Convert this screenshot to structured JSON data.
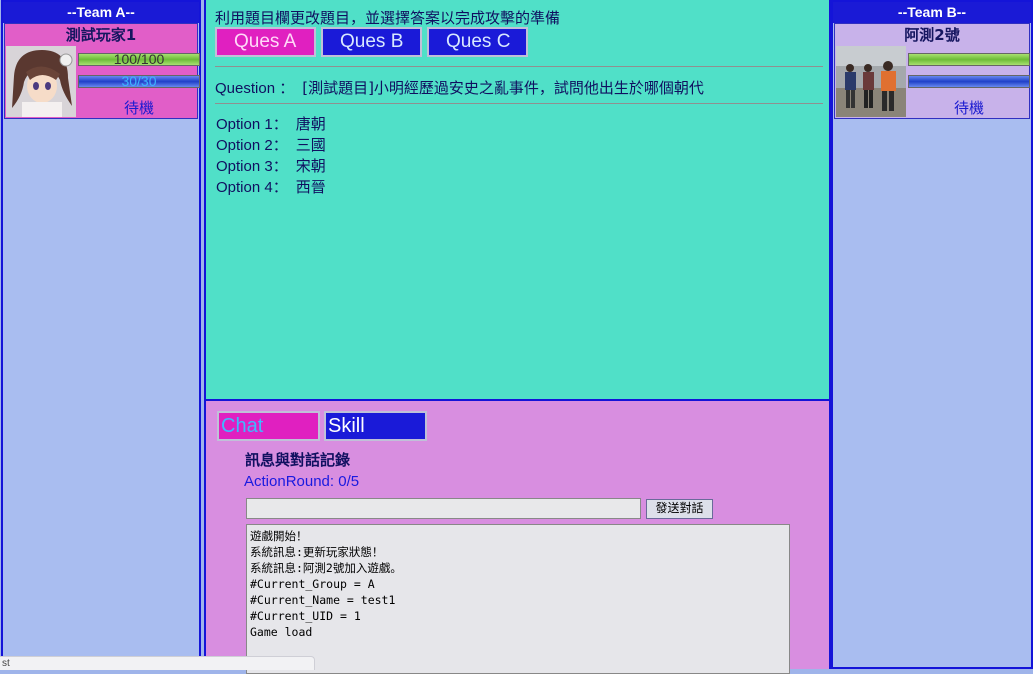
{
  "team_a": {
    "title": "--Team A--",
    "player": {
      "name": "測試玩家1",
      "hp_text": "100/100",
      "hp_fraction": 1.0,
      "mp_text": "30/30",
      "mp_fraction": 1.0,
      "status": "待機"
    }
  },
  "team_b": {
    "title": "--Team B--",
    "player": {
      "name": "阿測2號",
      "hp_text": "",
      "hp_fraction": 1.0,
      "mp_text": "",
      "mp_fraction": 1.0,
      "status": "待機"
    }
  },
  "question_panel": {
    "instruction": "利用題目欄更改題目，並選擇答案以完成攻擊的準備",
    "tabs": [
      "Ques A",
      "Ques B",
      "Ques C"
    ],
    "question_label": "Question ：",
    "question_text": "[測試題目]小明經歷過安史之亂事件，試問他出生於哪個朝代",
    "options": [
      {
        "label": "Option 1：",
        "text": "唐朝"
      },
      {
        "label": "Option 2：",
        "text": "三國"
      },
      {
        "label": "Option 3：",
        "text": "宋朝"
      },
      {
        "label": "Option 4：",
        "text": "西晉"
      }
    ]
  },
  "chat_panel": {
    "tabs": [
      "Chat",
      "Skill"
    ],
    "log_title": "訊息與對話記錄",
    "action_round": "ActionRound: 0/5",
    "input_value": "",
    "send_label": "發送對話",
    "log_lines": [
      "遊戲開始！",
      "系統訊息:更新玩家狀態！",
      "系統訊息:阿測2號加入遊戲。",
      "#Current_Group = A",
      "#Current_Name = test1",
      "#Current_UID = 1",
      "Game load"
    ]
  },
  "status_tip": "st",
  "colors": {
    "team_header": "#1a1ad6",
    "question_bg": "#50e0c8",
    "chat_bg": "#d88ee0",
    "active_tab": "#e020c0",
    "inactive_tab": "#1a1ad8"
  }
}
